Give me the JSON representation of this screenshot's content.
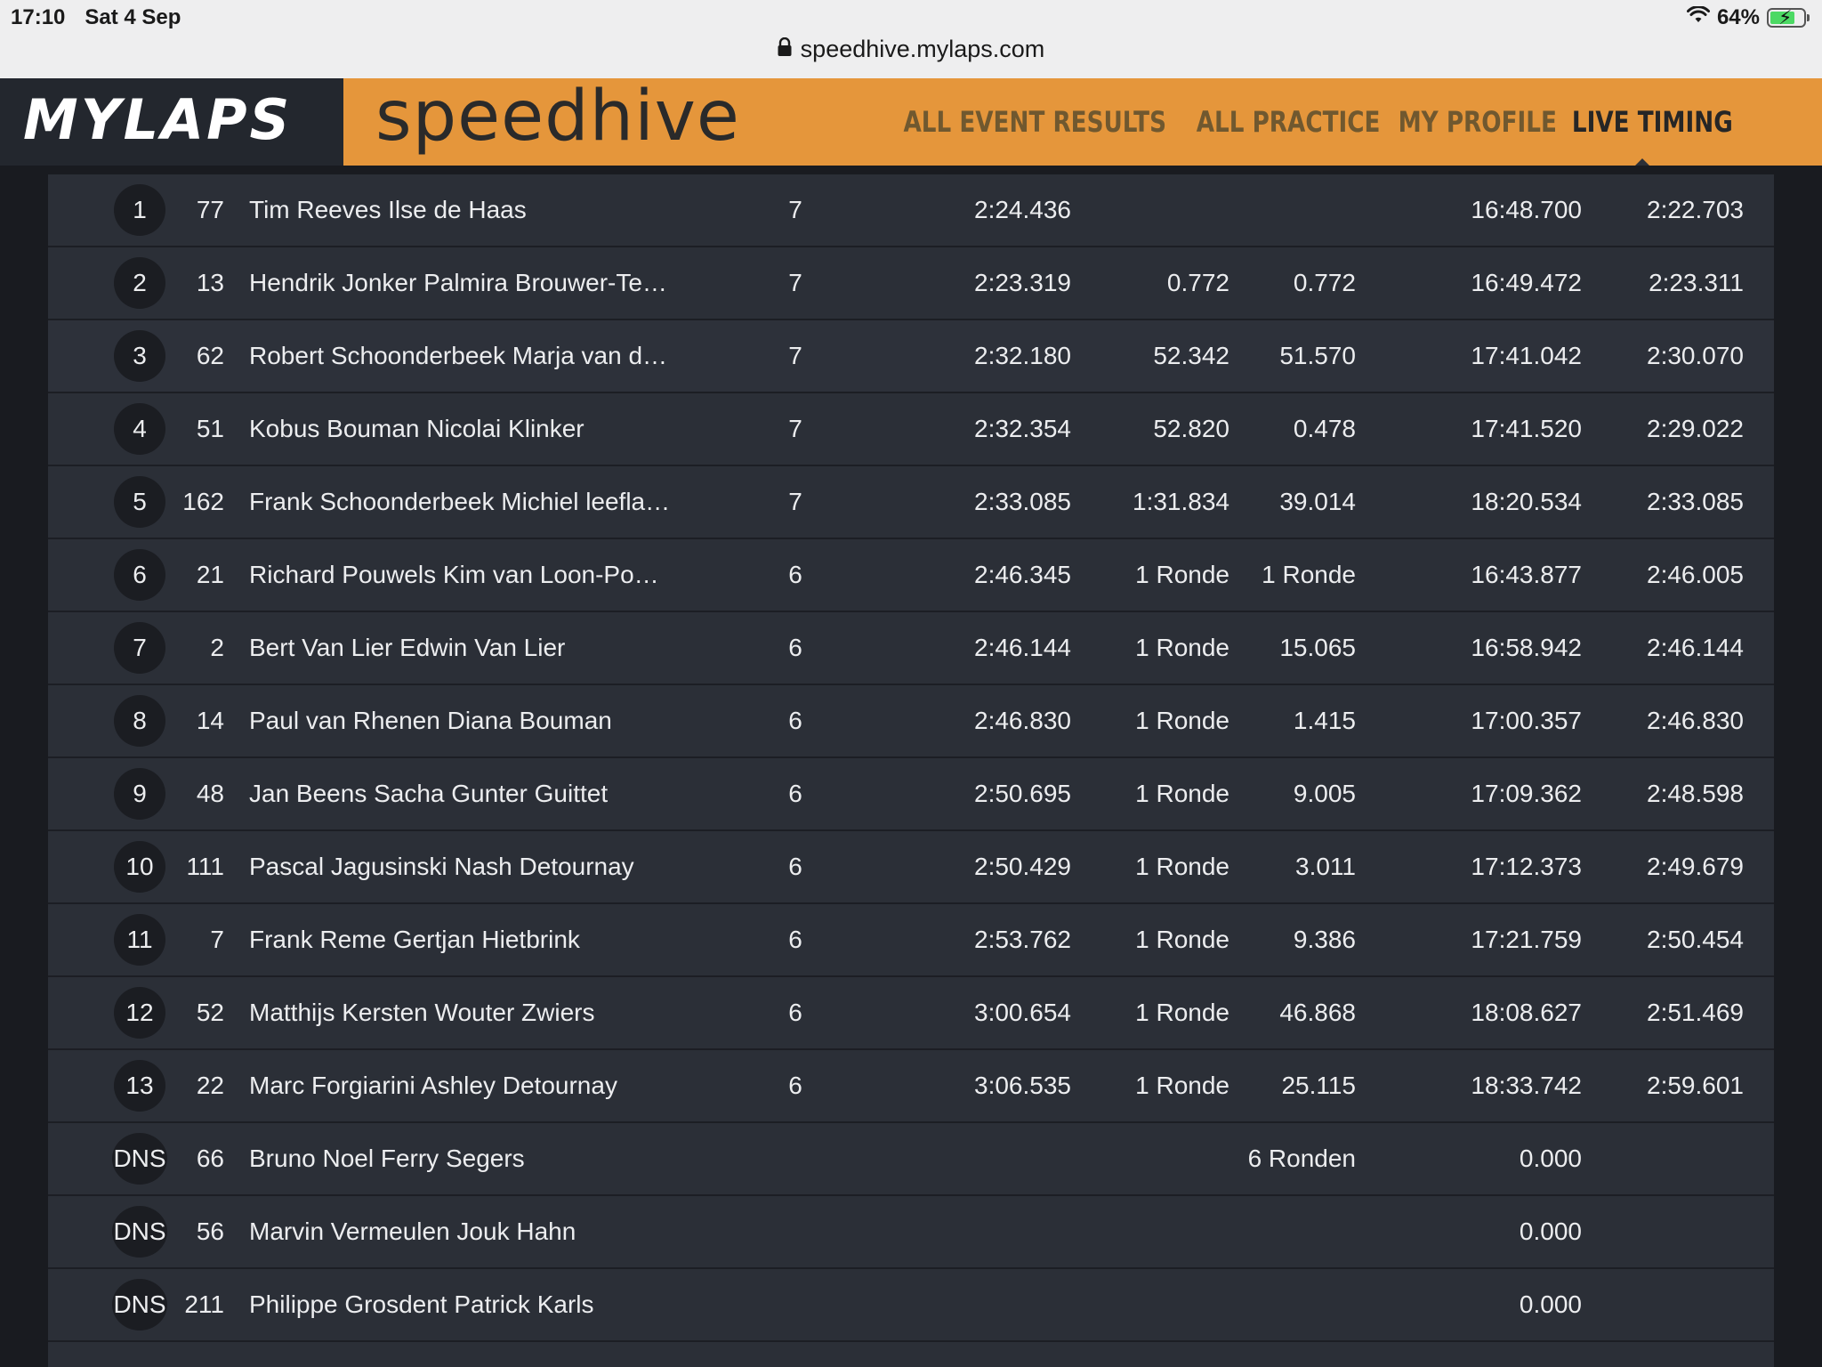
{
  "status_bar": {
    "time": "17:10",
    "date": "Sat 4 Sep",
    "battery": "64%",
    "url": "speedhive.mylaps.com"
  },
  "header": {
    "brand": "MYLAPS",
    "product": "speedhive",
    "nav": [
      "ALL EVENT RESULTS",
      "ALL PRACTICE",
      "MY PROFILE",
      "LIVE TIMING"
    ],
    "active_nav": "LIVE TIMING",
    "accent_color": "#e5963b"
  },
  "results": [
    {
      "pos": "1",
      "num": "77",
      "name": "Tim Reeves Ilse de Haas",
      "laps": "7",
      "last": "2:24.436",
      "gap": "",
      "diff": "",
      "total": "16:48.700",
      "best": "2:22.703"
    },
    {
      "pos": "2",
      "num": "13",
      "name": "Hendrik Jonker Palmira Brouwer-Te…",
      "laps": "7",
      "last": "2:23.319",
      "gap": "0.772",
      "diff": "0.772",
      "total": "16:49.472",
      "best": "2:23.311"
    },
    {
      "pos": "3",
      "num": "62",
      "name": "Robert Schoonderbeek Marja van d…",
      "laps": "7",
      "last": "2:32.180",
      "gap": "52.342",
      "diff": "51.570",
      "total": "17:41.042",
      "best": "2:30.070"
    },
    {
      "pos": "4",
      "num": "51",
      "name": "Kobus Bouman Nicolai Klinker",
      "laps": "7",
      "last": "2:32.354",
      "gap": "52.820",
      "diff": "0.478",
      "total": "17:41.520",
      "best": "2:29.022"
    },
    {
      "pos": "5",
      "num": "162",
      "name": "Frank Schoonderbeek Michiel leefla…",
      "laps": "7",
      "last": "2:33.085",
      "gap": "1:31.834",
      "diff": "39.014",
      "total": "18:20.534",
      "best": "2:33.085"
    },
    {
      "pos": "6",
      "num": "21",
      "name": "Richard Pouwels Kim van Loon-Po…",
      "laps": "6",
      "last": "2:46.345",
      "gap": "1 Ronde",
      "diff": "1 Ronde",
      "total": "16:43.877",
      "best": "2:46.005"
    },
    {
      "pos": "7",
      "num": "2",
      "name": "Bert Van Lier Edwin Van Lier",
      "laps": "6",
      "last": "2:46.144",
      "gap": "1 Ronde",
      "diff": "15.065",
      "total": "16:58.942",
      "best": "2:46.144"
    },
    {
      "pos": "8",
      "num": "14",
      "name": "Paul van Rhenen Diana Bouman",
      "laps": "6",
      "last": "2:46.830",
      "gap": "1 Ronde",
      "diff": "1.415",
      "total": "17:00.357",
      "best": "2:46.830"
    },
    {
      "pos": "9",
      "num": "48",
      "name": "Jan Beens Sacha Gunter Guittet",
      "laps": "6",
      "last": "2:50.695",
      "gap": "1 Ronde",
      "diff": "9.005",
      "total": "17:09.362",
      "best": "2:48.598"
    },
    {
      "pos": "10",
      "num": "111",
      "name": "Pascal Jagusinski Nash Detournay",
      "laps": "6",
      "last": "2:50.429",
      "gap": "1 Ronde",
      "diff": "3.011",
      "total": "17:12.373",
      "best": "2:49.679"
    },
    {
      "pos": "11",
      "num": "7",
      "name": "Frank Reme Gertjan Hietbrink",
      "laps": "6",
      "last": "2:53.762",
      "gap": "1 Ronde",
      "diff": "9.386",
      "total": "17:21.759",
      "best": "2:50.454"
    },
    {
      "pos": "12",
      "num": "52",
      "name": "Matthijs Kersten Wouter Zwiers",
      "laps": "6",
      "last": "3:00.654",
      "gap": "1 Ronde",
      "diff": "46.868",
      "total": "18:08.627",
      "best": "2:51.469"
    },
    {
      "pos": "13",
      "num": "22",
      "name": "Marc Forgiarini Ashley Detournay",
      "laps": "6",
      "last": "3:06.535",
      "gap": "1 Ronde",
      "diff": "25.115",
      "total": "18:33.742",
      "best": "2:59.601"
    },
    {
      "pos": "DNS",
      "num": "66",
      "name": "Bruno Noel Ferry Segers",
      "laps": "",
      "last": "",
      "gap": "",
      "diff": "6 Ronden",
      "total": "0.000",
      "best": ""
    },
    {
      "pos": "DNS",
      "num": "56",
      "name": "Marvin Vermeulen Jouk Hahn",
      "laps": "",
      "last": "",
      "gap": "",
      "diff": "",
      "total": "0.000",
      "best": ""
    },
    {
      "pos": "DNS",
      "num": "211",
      "name": "Philippe Grosdent Patrick Karls",
      "laps": "",
      "last": "",
      "gap": "",
      "diff": "",
      "total": "0.000",
      "best": ""
    }
  ]
}
